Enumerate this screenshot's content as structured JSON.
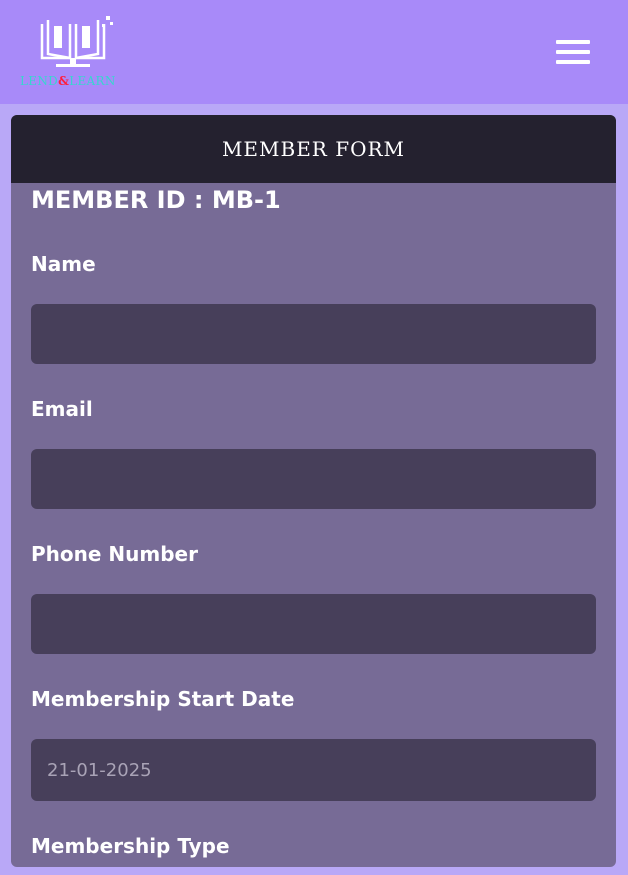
{
  "header": {
    "logo": {
      "word1": "LEND",
      "ampersand": "&",
      "word2": "LEARN",
      "icon": "book-icon"
    },
    "menu_icon": "hamburger-menu-icon",
    "colors": {
      "bar": "#a88af9"
    }
  },
  "form": {
    "title": "MEMBER FORM",
    "member_id": "MEMBER ID : MB-1",
    "fields": [
      {
        "label": "Name",
        "value": ""
      },
      {
        "label": "Email",
        "value": ""
      },
      {
        "label": "Phone Number",
        "value": ""
      },
      {
        "label": "Membership Start Date",
        "value": "21-01-2025"
      },
      {
        "label": "Membership Type"
      }
    ],
    "colors": {
      "card": "#776b96",
      "header": "#24212f",
      "input": "#473f5a"
    }
  }
}
